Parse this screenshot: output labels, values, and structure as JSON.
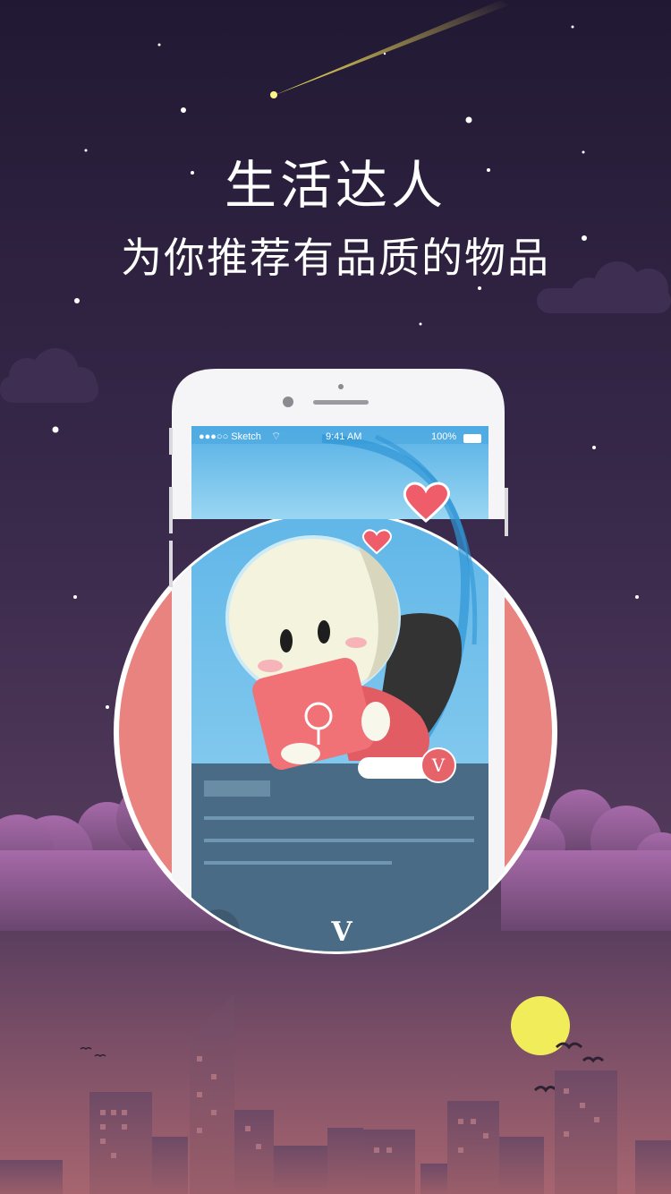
{
  "headline": {
    "title": "生活达人",
    "subtitle": "为你推荐有品质的物品"
  },
  "phone": {
    "status_bar": {
      "carrier": "●●●○○ Sketch",
      "time": "9:41 AM",
      "battery": "100%"
    },
    "avatar_badge": "V",
    "bottom_logo": "V"
  },
  "colors": {
    "sky_top": "#231a36",
    "sky_bottom": "#7a4f6d",
    "circle": "#e9837f",
    "phone_screen_top": "#67b8e8",
    "phone_panel": "#4a6b86",
    "moon": "#f0ec5a"
  }
}
